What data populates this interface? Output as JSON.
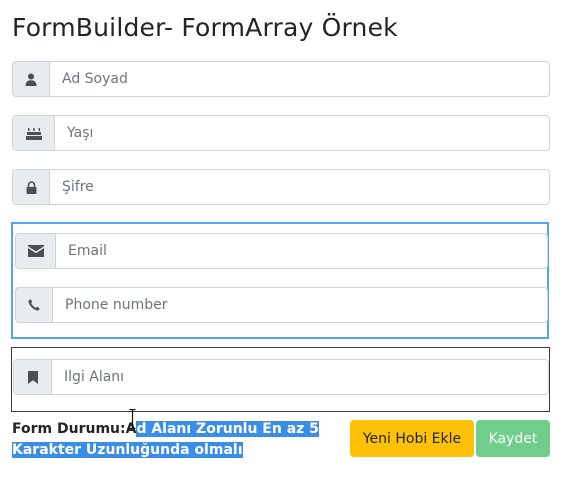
{
  "page": {
    "title": "FormBuilder- FormArray Örnek"
  },
  "fields": {
    "name": {
      "placeholder": "Ad Soyad",
      "icon": "user-icon"
    },
    "age": {
      "placeholder": "Yaşı",
      "icon": "birthday-cake-icon"
    },
    "password": {
      "placeholder": "Şifre",
      "icon": "lock-icon"
    },
    "email": {
      "placeholder": "Email",
      "icon": "envelope-icon"
    },
    "phone": {
      "placeholder": "Phone number",
      "icon": "phone-icon"
    },
    "interest": {
      "placeholder": "İlgi Alanı",
      "icon": "bookmark-icon"
    }
  },
  "status": {
    "label": "Form Durumu:",
    "prefix": "A",
    "selected_text": "d Alanı Zorunlu En az 5 Karakter Uzunluğunda olmalı"
  },
  "buttons": {
    "add_hobby_label": "Yeni Hobi Ekle",
    "save_label": "Kaydet"
  },
  "colors": {
    "group_border_active": "#52a8ec",
    "group_border_default": "#343a40",
    "warning": "#ffc107",
    "success": "#6fcf8a",
    "selection": "#3b8ee8"
  }
}
